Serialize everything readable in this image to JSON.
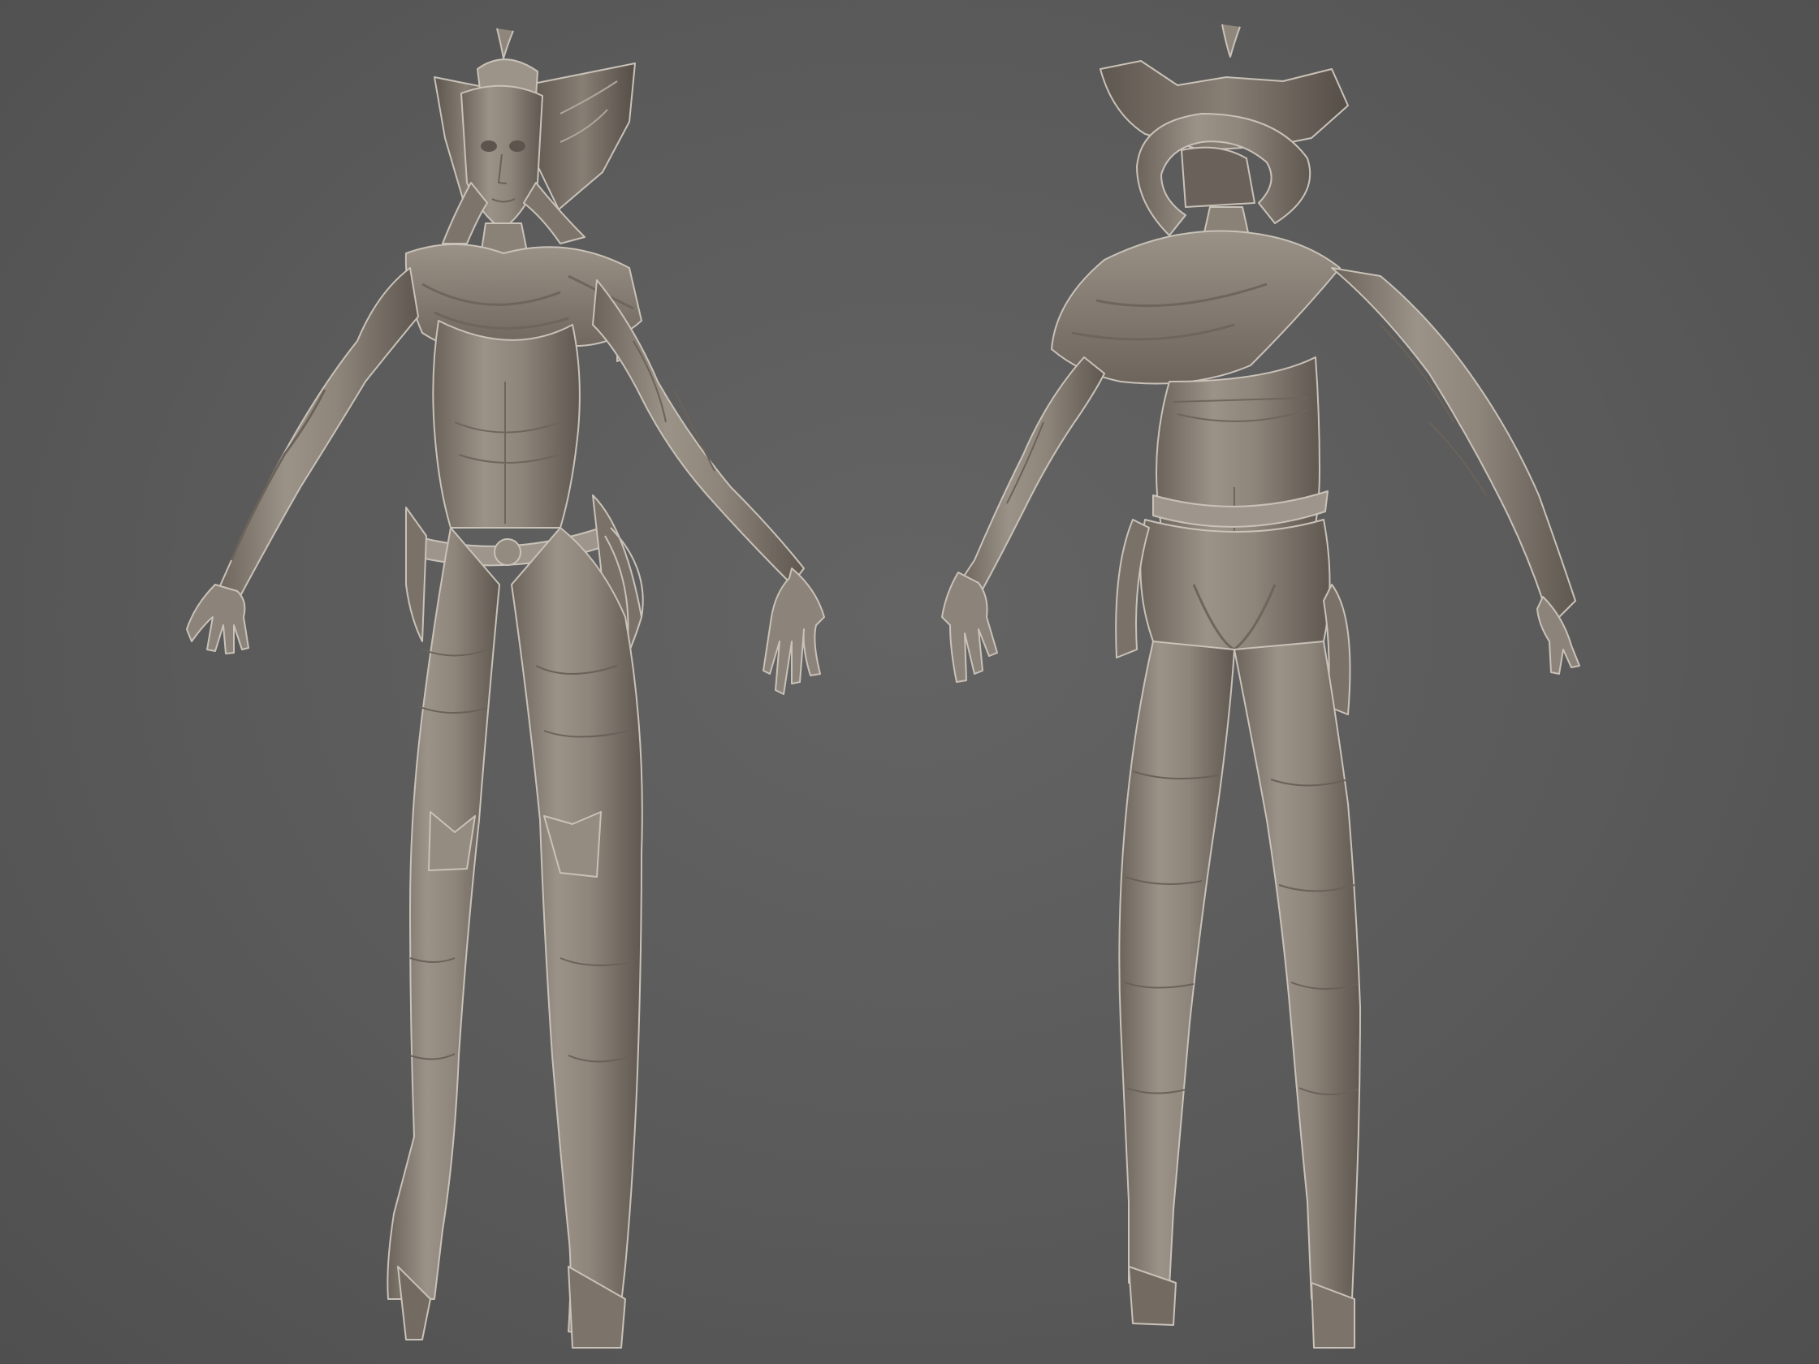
{
  "scene": {
    "background_color": "#595959",
    "material_color": "#8a8177",
    "material_highlight": "#b3aba1",
    "material_shadow": "#5e5750"
  },
  "figures": [
    {
      "view": "front",
      "icon": "sculpt-figure-front"
    },
    {
      "view": "back",
      "icon": "sculpt-figure-back"
    }
  ]
}
